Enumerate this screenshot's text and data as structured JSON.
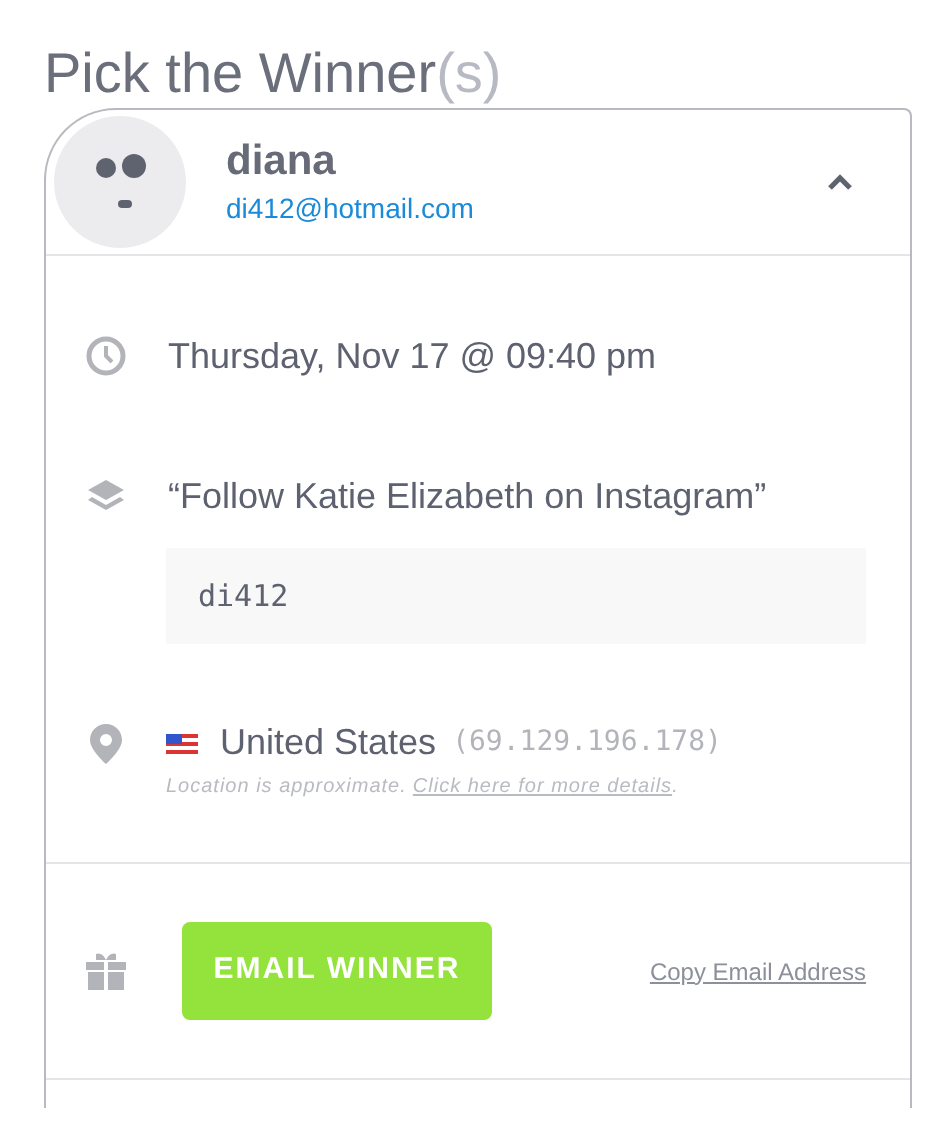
{
  "title": {
    "text": "Pick the Winner",
    "suffix": "(s)"
  },
  "winner": {
    "name": "diana",
    "email": "di412@hotmail.com",
    "expanded": true,
    "time": "Thursday, Nov 17 @ 09:40 pm",
    "entry": {
      "action": "“Follow Katie Elizabeth on Instagram”",
      "value": "di412"
    },
    "location": {
      "country": "United States",
      "ip": "(69.129.196.178)",
      "note": "Location is approximate.",
      "link": "Click here for more details",
      "note_end": "."
    },
    "actions": {
      "button": "EMAIL WINNER",
      "link": "Copy Email Address"
    }
  }
}
